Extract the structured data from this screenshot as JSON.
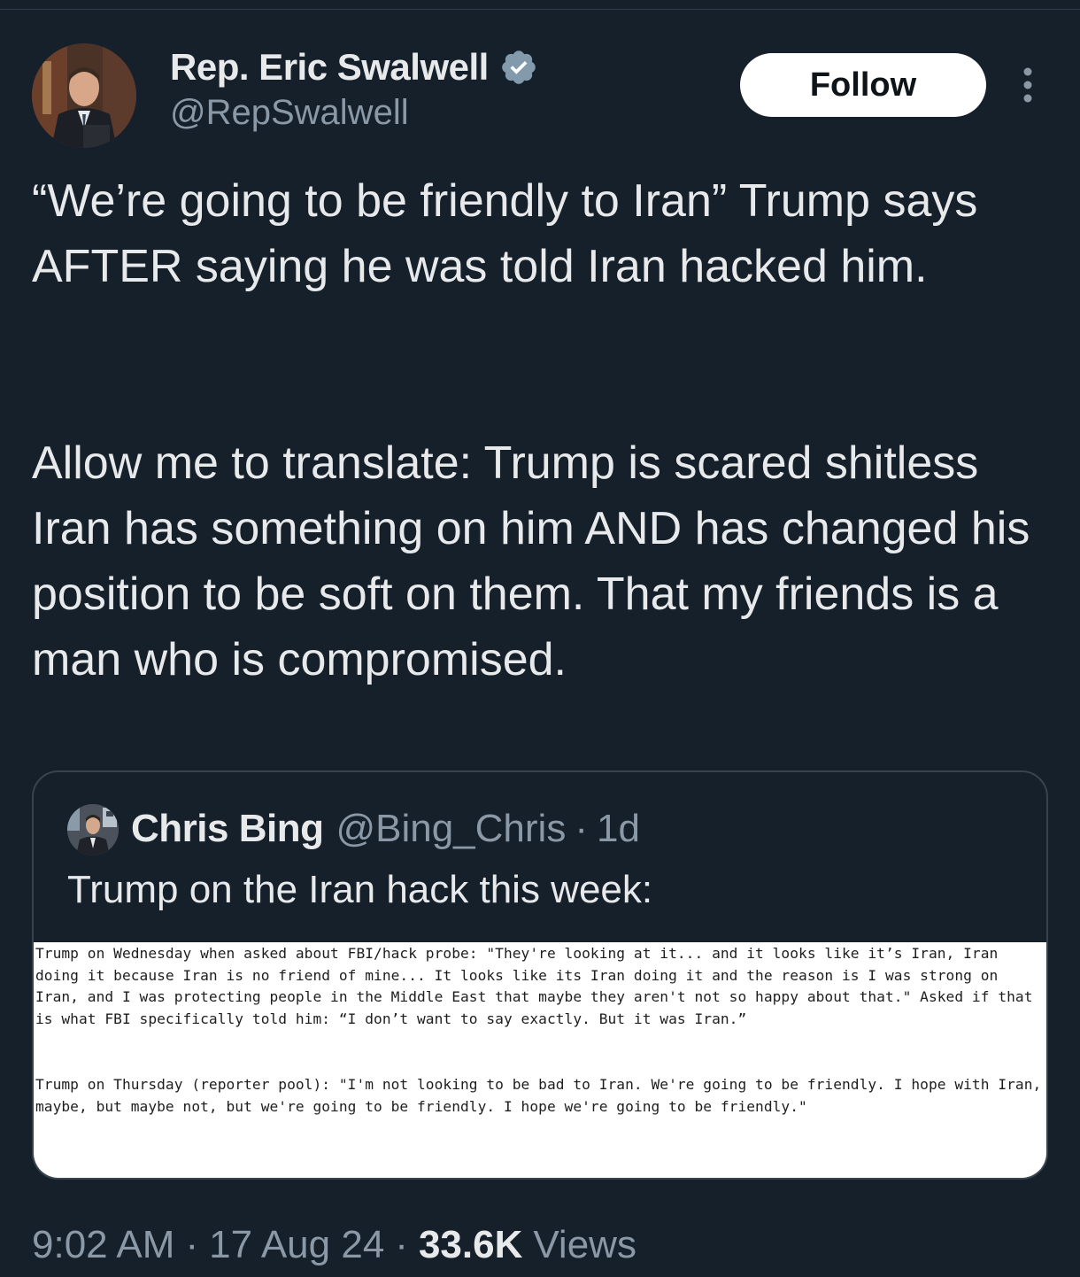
{
  "tweet": {
    "author": {
      "display_name": "Rep. Eric Swalwell",
      "handle": "@RepSwalwell",
      "verified": true,
      "verified_badge_color": "#829aab",
      "avatar_icon": "profile-photo"
    },
    "follow_label": "Follow",
    "more_icon": "more-vertical-icon",
    "paragraphs": [
      "“We’re going to be friendly to Iran” Trump says AFTER saying he was told Iran hacked him.",
      "Allow me to translate: Trump is scared shitless Iran has something on him AND has changed his position to be soft on them. That my friends is a man who is compromised."
    ],
    "quoted_tweet": {
      "display_name": "Chris Bing",
      "handle": "@Bing_Chris",
      "separator": "·",
      "time_ago": "1d",
      "text": "Trump on the Iran hack this week:",
      "media_paragraphs": [
        "Trump on Wednesday when asked about FBI/hack probe: \"They're looking at it... and it looks like it’s Iran, Iran doing it because Iran is no friend of mine... It looks like its Iran doing it and the reason is I was strong on Iran, and I was protecting people in the Middle East that maybe they aren't not so happy about that.\" Asked if that is what FBI specifically told him: “I don’t want to say exactly. But it was Iran.”",
        "Trump on Thursday (reporter pool): \"I'm not looking to be bad to Iran. We're going to be friendly. I hope with Iran, maybe, but maybe not, but we're going to be friendly. I hope we're going to be friendly.\""
      ]
    },
    "footer": {
      "time": "9:02 AM",
      "separator": "·",
      "date": "17 Aug 24",
      "views_count": "33.6K",
      "views_label": "Views"
    }
  },
  "colors": {
    "background": "#15202b",
    "primary_text": "#e7e9ea",
    "secondary_text": "#8b98a5",
    "border": "#38444d",
    "follow_bg": "#ffffff",
    "follow_text": "#0f1419"
  }
}
